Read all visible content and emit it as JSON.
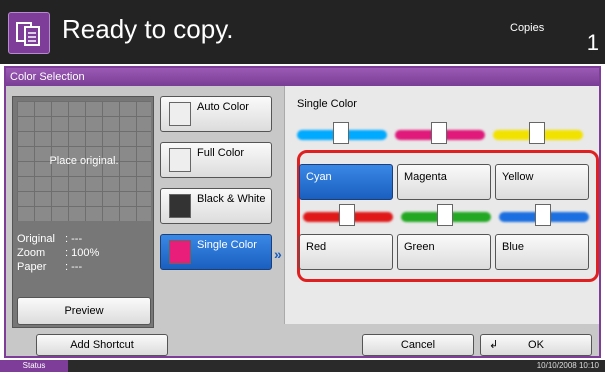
{
  "header": {
    "title": "Ready to copy.",
    "copies_label": "Copies",
    "copies_value": "1",
    "app_icon": "copy-icon"
  },
  "section": {
    "title": "Color Selection"
  },
  "preview": {
    "placeholder": "Place original.",
    "info": [
      {
        "label": "Original",
        "value": ": ---"
      },
      {
        "label": "Zoom",
        "value": ": 100%"
      },
      {
        "label": "Paper",
        "value": ": ---"
      }
    ],
    "preview_button": "Preview"
  },
  "modes": [
    {
      "label": "Auto Color",
      "active": false
    },
    {
      "label": "Full Color",
      "active": false
    },
    {
      "label": "Black & White",
      "active": false
    },
    {
      "label": "Single Color",
      "active": true
    }
  ],
  "single_color": {
    "title": "Single Color",
    "colors": [
      {
        "label": "Cyan",
        "selected": true,
        "hex": "#00aaff"
      },
      {
        "label": "Magenta",
        "selected": false,
        "hex": "#e0197a"
      },
      {
        "label": "Yellow",
        "selected": false,
        "hex": "#f2e200"
      },
      {
        "label": "Red",
        "selected": false,
        "hex": "#e01818"
      },
      {
        "label": "Green",
        "selected": false,
        "hex": "#22a822"
      },
      {
        "label": "Blue",
        "selected": false,
        "hex": "#1c6fe0"
      }
    ]
  },
  "footer": {
    "add_shortcut": "Add Shortcut",
    "cancel": "Cancel",
    "ok": "OK"
  },
  "status_bar": {
    "status": "Status",
    "datetime": "10/10/2008   10:10"
  }
}
